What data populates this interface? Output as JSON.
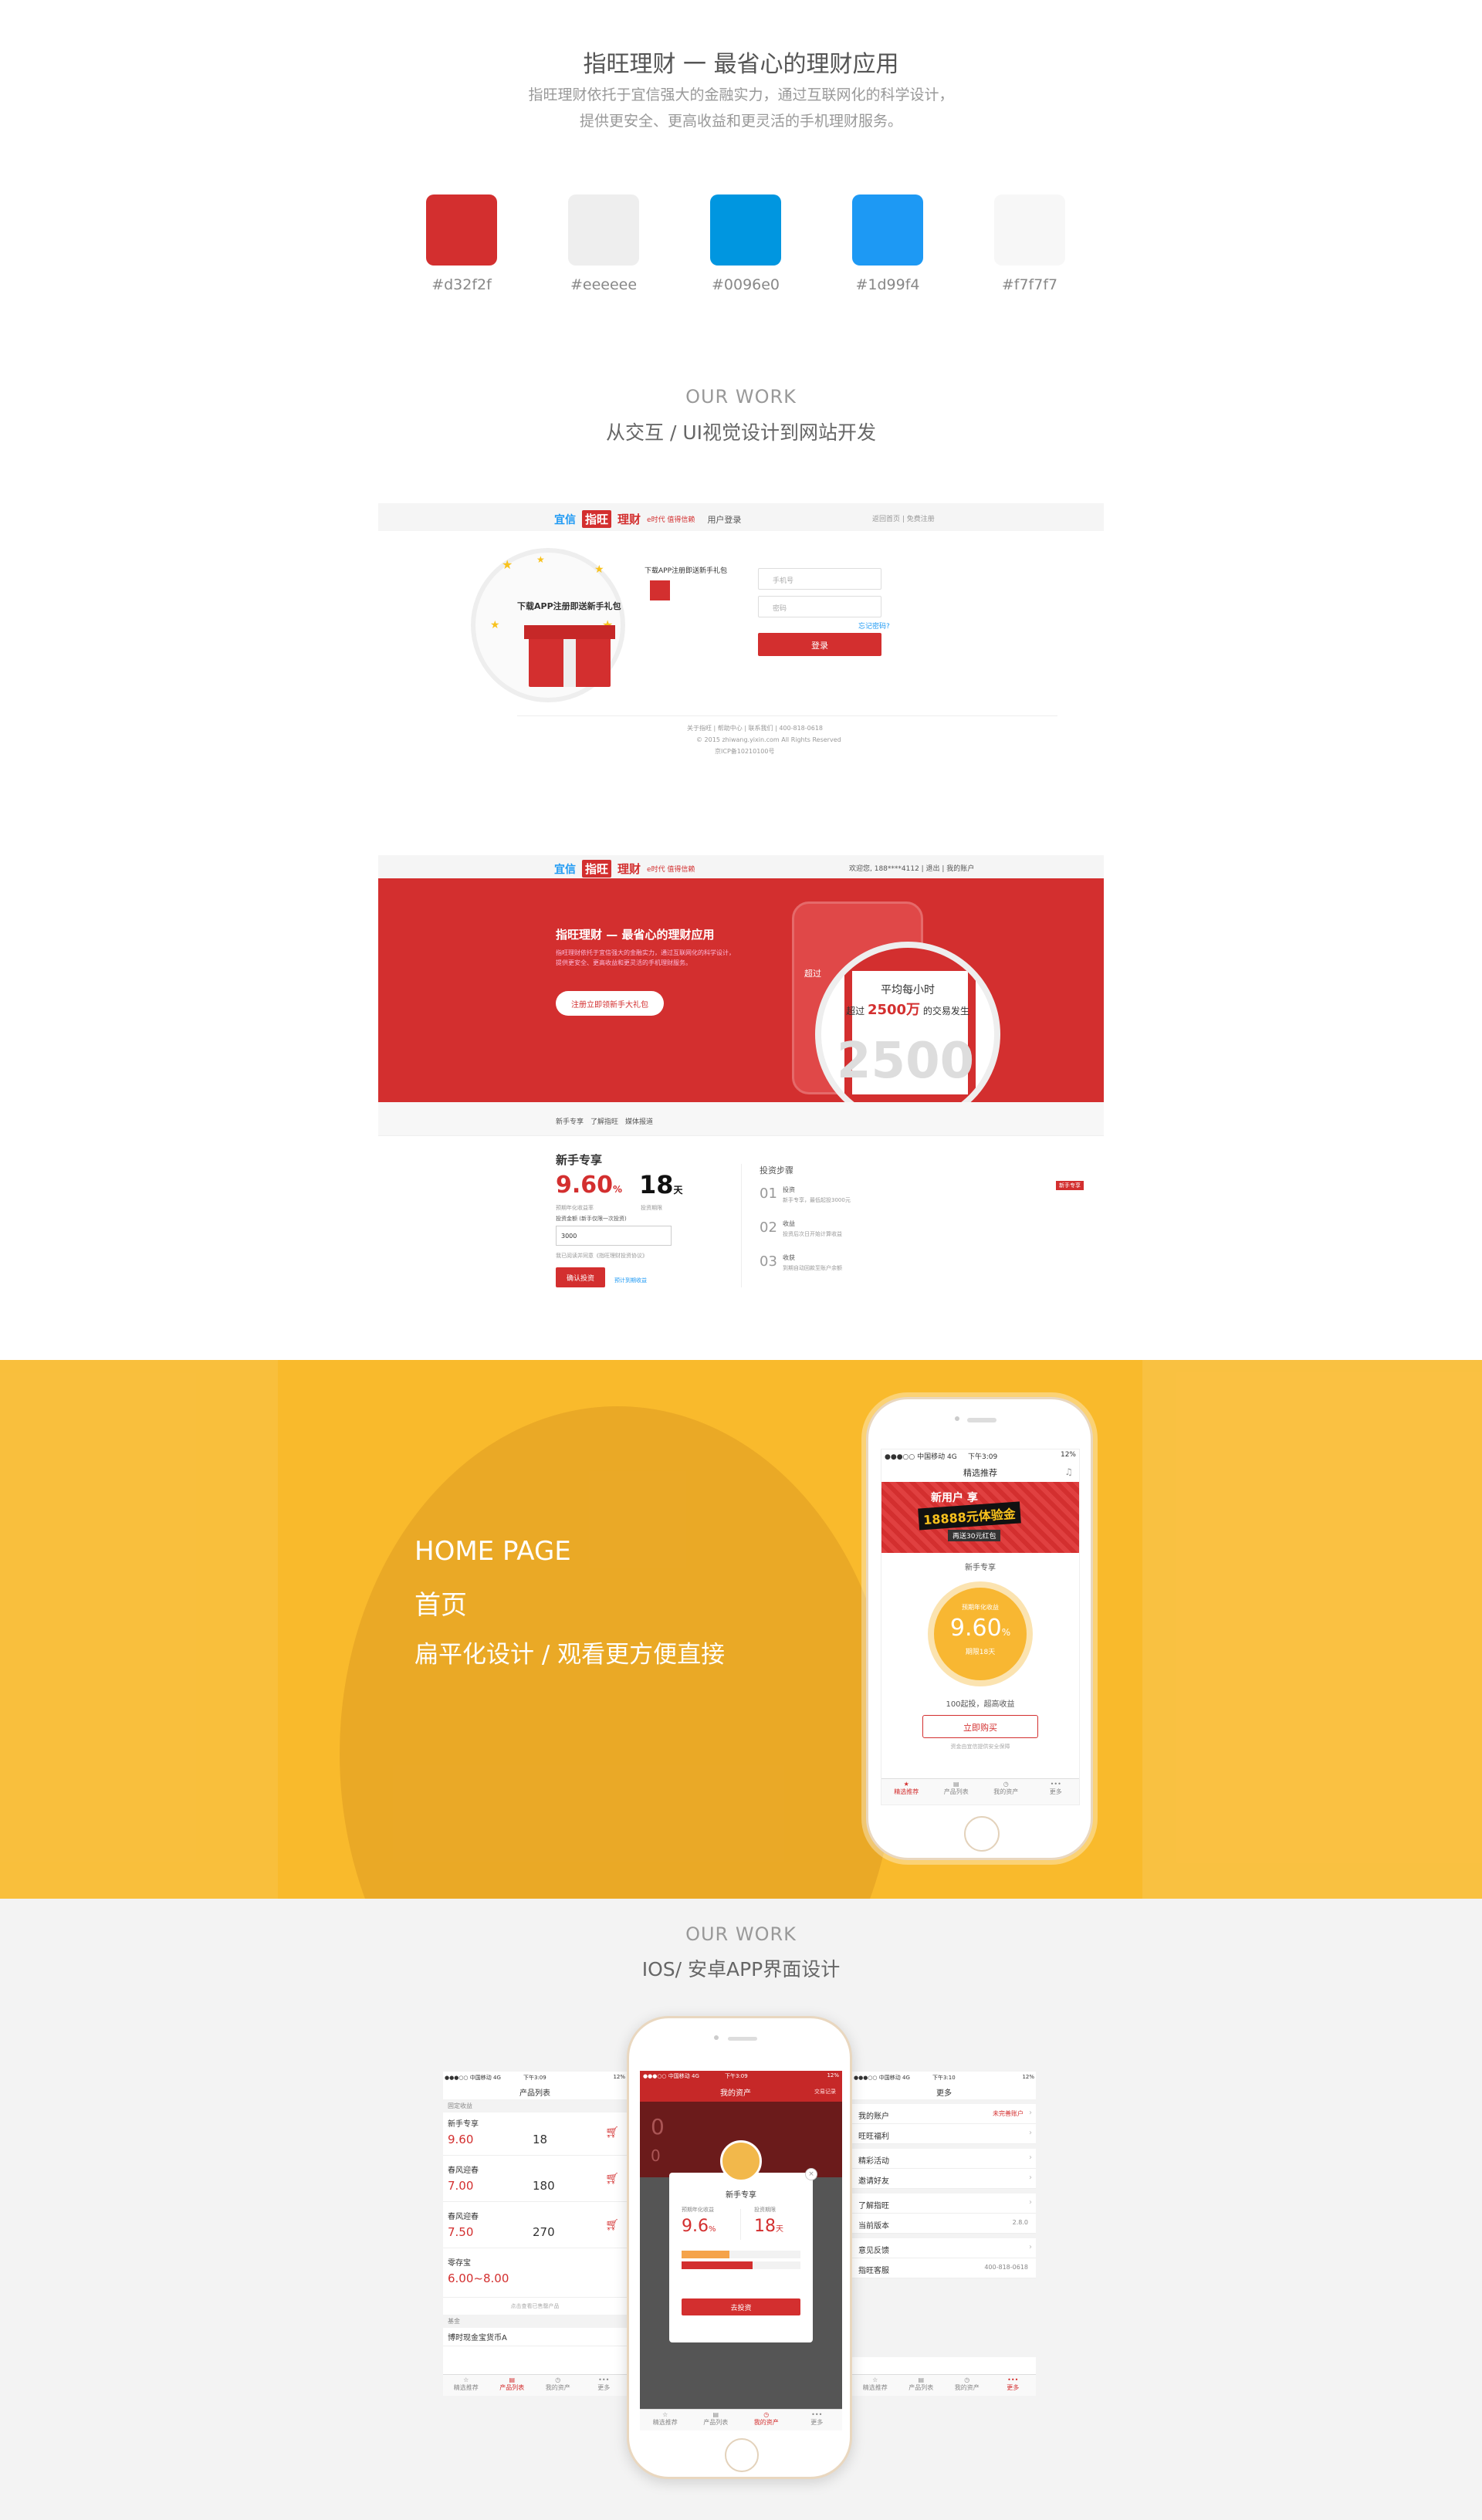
{
  "intro": {
    "title": "指旺理财 一 最省心的理财应用",
    "desc_line1": "指旺理财依托于宜信强大的金融实力，通过互联网化的科学设计，",
    "desc_line2": "提供更安全、更高收益和更灵活的手机理财服务。"
  },
  "palette": [
    {
      "hex": "#d32f2f",
      "label": "#d32f2f"
    },
    {
      "hex": "#eeeeee",
      "label": "#eeeeee"
    },
    {
      "hex": "#0096e0",
      "label": "#0096e0"
    },
    {
      "hex": "#1d99f4",
      "label": "#1d99f4"
    },
    {
      "hex": "#f7f7f7",
      "label": "#f7f7f7"
    }
  ],
  "our_work_1": {
    "en": "OUR WORK",
    "cn": "从交互 / UI视觉设计到网站开发"
  },
  "login_page": {
    "logo_yixin": "宜信",
    "logo_zhiwang": "指旺",
    "logo_licai": "理财",
    "slogan": "e时代 值得信赖",
    "page_label": "用户登录",
    "top_links": "返回首页 | 免费注册",
    "gift_text": "下载APP注册即送新手礼包",
    "gift_side": "下载APP注册即送新手礼包",
    "phone_placeholder": "手机号",
    "password_placeholder": "密码",
    "forgot": "忘记密码?",
    "login_button": "登录",
    "footer_links": "关于指旺 | 帮助中心 | 联系我们 | 400-818-0618",
    "copyright": "© 2015 zhiwang.yixin.com All Rights Reserved",
    "icp": "京ICP备10210100号"
  },
  "home_web": {
    "top_user": "欢迎您, 188****4112 | 退出 | 我的账户",
    "banner_title": "指旺理财 — 最省心的理财应用",
    "banner_desc1": "指旺理财依托于宜信强大的金融实力，通过互联网化的科学设计，",
    "banner_desc2": "提供更安全、更高收益和更灵活的手机理财服务。",
    "gift_btn": "注册立即领新手大礼包",
    "zoom_line1": "平均每小时",
    "zoom_line2_pre": "超过",
    "zoom_big": "2500万",
    "zoom_line2_post": "的交易发生",
    "zoom_number": "2500",
    "phone_hint": "超过",
    "nav_items": [
      "新手专享",
      "了解指旺",
      "媒体报道"
    ],
    "newbie_title": "新手专享",
    "rate": "9.60",
    "rate_unit": "%",
    "days": "18",
    "days_unit": "天",
    "rate_label": "预期年化收益率",
    "days_label": "投资期限",
    "amount_hint": "投资金额 (新手仅限一次投资)",
    "amount_value": "3000",
    "agree_text": "我已阅读并同意《指旺理财投资协议》",
    "confirm_btn": "确认投资",
    "small_note": "预计到期收益",
    "steps_title": "投资步骤",
    "steps": [
      {
        "num": "01",
        "title": "投资",
        "desc": "新手专享，最低起投3000元"
      },
      {
        "num": "02",
        "title": "收益",
        "desc": "投资后次日开始计算收益"
      },
      {
        "num": "03",
        "title": "收获",
        "desc": "到期自动回款至账户余额"
      }
    ],
    "tag": "新手专享"
  },
  "hero": {
    "en": "HOME PAGE",
    "cn": "首页",
    "sub": "扁平化设计 / 观看更方便直接",
    "phone": {
      "carrier": "●●●○○ 中国移动 4G",
      "time": "下午3:09",
      "battery": "12%",
      "nav_title": "精选推荐",
      "banner_top": "新用户 享",
      "banner_main": "18888元体验金",
      "banner_sub": "再送30元红包",
      "section": "新手专享",
      "rate_label": "预期年化收益",
      "rate": "9.60",
      "rate_unit": "%",
      "term": "期限18天",
      "note": "100起投，超高收益",
      "buy_btn": "立即购买",
      "safe": "资金由宜信提供安全保障",
      "tabs": [
        "精选推荐",
        "产品列表",
        "我的资产",
        "更多"
      ]
    }
  },
  "our_work_2": {
    "en": "OUR WORK",
    "cn": "IOS/ 安卓APP界面设计"
  },
  "app_screens": {
    "status_carrier": "●●●○○ 中国移动 4G",
    "time_a": "下午3:09",
    "time_b": "下午3:10",
    "battery": "12%",
    "list_title": "产品列表",
    "list_group": "固定收益",
    "products": [
      {
        "name": "新手专享",
        "rate": "9.60",
        "term": "18"
      },
      {
        "name": "春风迎春",
        "rate": "7.00",
        "term": "180"
      },
      {
        "name": "春风迎春",
        "rate": "7.50",
        "term": "270"
      },
      {
        "name": "零存宝",
        "rate": "6.00~8.00",
        "term": ""
      }
    ],
    "more_link": "点击查看已售罄产品",
    "fund_group": "基金",
    "fund_item": "博时现金宝货币A",
    "asset_title": "我的资产",
    "asset_right": "交易记录",
    "asset_zero": "0",
    "popup_title": "新手专享",
    "popup_rate_label": "预期年化收益",
    "popup_term_label": "投资期限",
    "popup_rate": "9.6",
    "popup_rate_unit": "%",
    "popup_term": "18",
    "popup_term_unit": "天",
    "popup_btn": "去投资",
    "more_title": "更多",
    "more_items": [
      {
        "label": "我的账户",
        "value": "未完善账户"
      },
      {
        "label": "旺旺福利",
        "value": ""
      },
      {
        "label": "精彩活动",
        "value": ""
      },
      {
        "label": "邀请好友",
        "value": ""
      },
      {
        "label": "了解指旺",
        "value": ""
      },
      {
        "label": "当前版本",
        "value": "2.8.0"
      },
      {
        "label": "意见反馈",
        "value": ""
      },
      {
        "label": "指旺客服",
        "value": "400-818-0618"
      }
    ],
    "tabs": [
      "精选推荐",
      "产品列表",
      "我的资产",
      "更多"
    ]
  }
}
